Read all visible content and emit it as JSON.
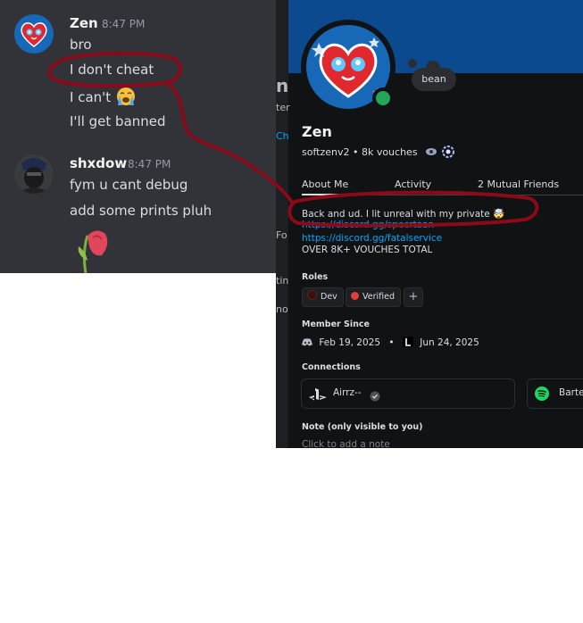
{
  "chat": {
    "messages": [
      {
        "author": "Zen",
        "time": "8:47 PM",
        "lines": [
          "bro",
          "I don't cheat",
          "I can't",
          "I'll get banned"
        ]
      },
      {
        "author": "shxdow",
        "time": "8:47 PM",
        "lines": [
          "fym u cant debug",
          "add some prints pluh"
        ]
      }
    ]
  },
  "background_fragments": [
    "n",
    "ter",
    "Ch",
    "Fo",
    "tin",
    "no"
  ],
  "profile": {
    "custom_status": "bean",
    "display_name": "Zen",
    "username_line": "softzenv2 • 8k vouches",
    "tabs": [
      "About Me",
      "Activity",
      "2 Mutual Friends"
    ],
    "bio": [
      "Back and ud. I lit unreal with my private 🤯",
      "https://discord.gg/specrtaan",
      "https://discord.gg/fatalservice",
      "OVER 8K+ VOUCHES TOTAL"
    ],
    "roles_heading": "Roles",
    "roles": [
      {
        "name": "Dev",
        "color": "#3a0f0f"
      },
      {
        "name": "Verified",
        "color": "#e23e3e"
      }
    ],
    "add_role": "+",
    "member_since_heading": "Member Since",
    "member_since_discord": "Feb 19, 2025",
    "member_since_server": "Jun 24, 2025",
    "separator": "•",
    "connections_heading": "Connections",
    "connections": [
      {
        "service": "playstation-icon",
        "account": "Airrz--"
      },
      {
        "service": "spotify-icon",
        "account": "Barte"
      }
    ],
    "note_heading": "Note (only visible to you)",
    "note_placeholder": "Click to add a note"
  },
  "colors": {
    "chat_bg": "#313338",
    "profile_bg": "#111214",
    "banner": "#0b4a8e",
    "online": "#23a55a",
    "link": "#00a8fc",
    "marker": "#8b0a1a"
  }
}
